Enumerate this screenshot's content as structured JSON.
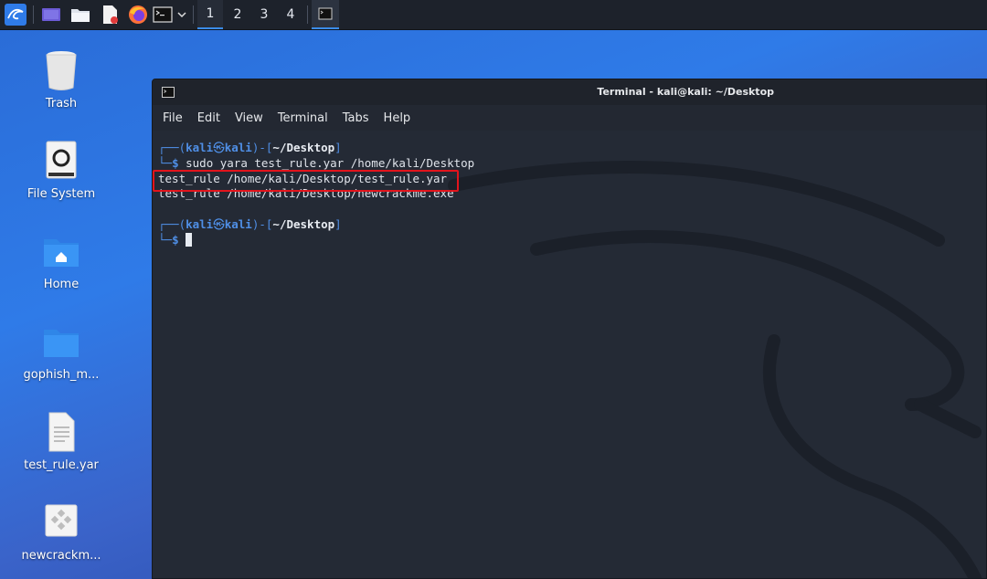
{
  "panel": {
    "workspaces": [
      "1",
      "2",
      "3",
      "4"
    ],
    "active_workspace": "1"
  },
  "desktop": {
    "icons": [
      {
        "label": "Trash"
      },
      {
        "label": "File System"
      },
      {
        "label": "Home"
      },
      {
        "label": "gophish_m..."
      },
      {
        "label": "test_rule.yar"
      },
      {
        "label": "newcrackm..."
      }
    ]
  },
  "terminal": {
    "title": "Terminal - kali@kali: ~/Desktop",
    "menu": [
      "File",
      "Edit",
      "View",
      "Terminal",
      "Tabs",
      "Help"
    ],
    "prompt": {
      "user_host_open": "┌──(",
      "user": "kali",
      "at": "㉿",
      "host": "kali",
      "mid": ")-[",
      "dir": "~/Desktop",
      "close": "]",
      "second": "└─",
      "dollar": "$"
    },
    "command": " sudo yara test_rule.yar /home/kali/Desktop",
    "output": [
      "test_rule /home/kali/Desktop/test_rule.yar",
      "test_rule /home/kali/Desktop/newcrackme.exe"
    ]
  },
  "colors": {
    "highlight_box": "#e3141c",
    "prompt_blue": "#4f8fe6"
  }
}
